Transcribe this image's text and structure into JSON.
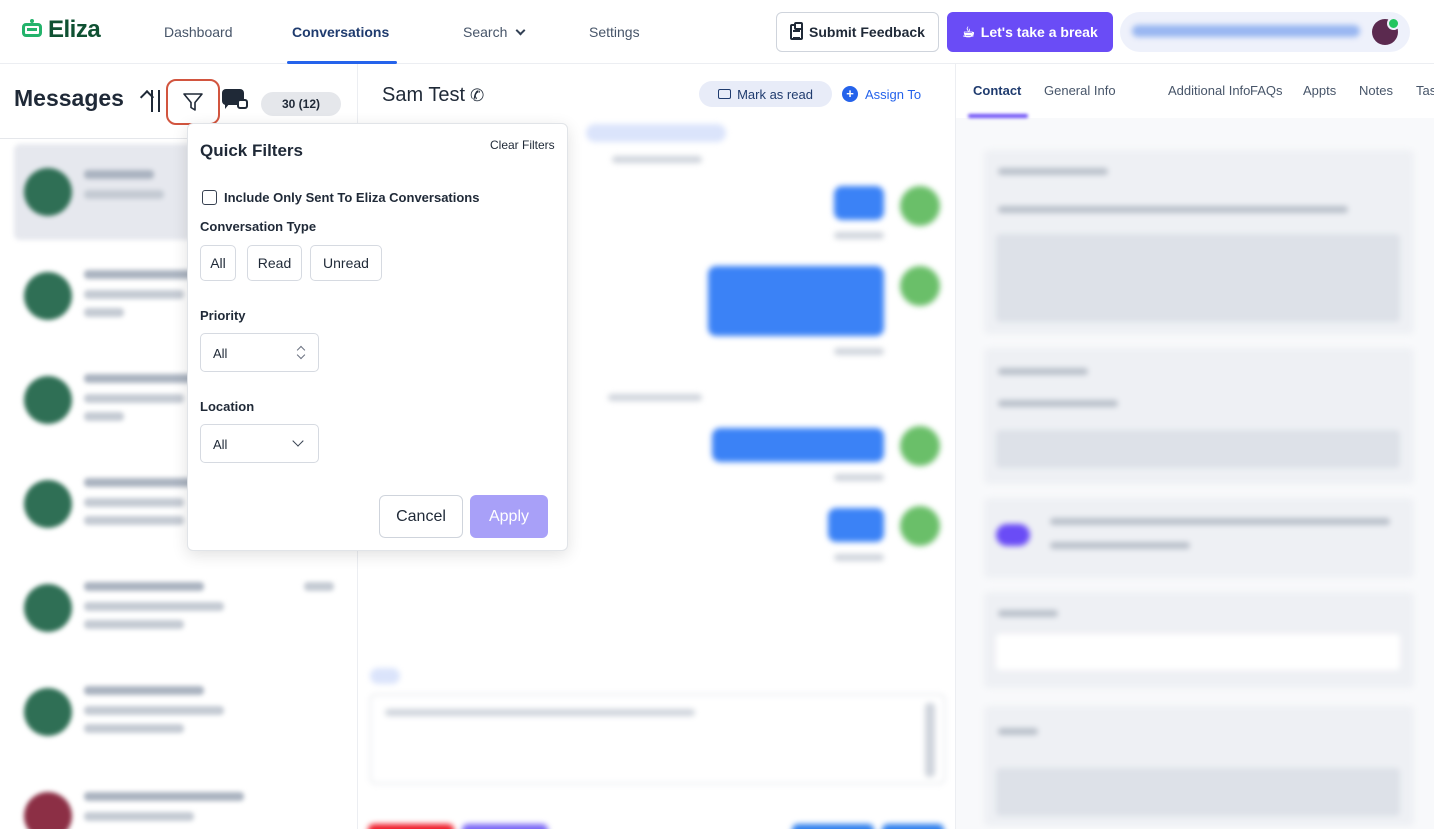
{
  "app": {
    "name": "Eliza"
  },
  "nav": {
    "links": [
      "Dashboard",
      "Conversations",
      "Search",
      "Settings"
    ],
    "active": "Conversations",
    "feedback_label": "Submit Feedback",
    "break_label": "Let's take a break"
  },
  "sidebar": {
    "title": "Messages",
    "count_badge": "30 (12)"
  },
  "chat": {
    "contact_name": "Sam Test",
    "mark_read_label": "Mark as read",
    "assign_label": "Assign To"
  },
  "right_panel": {
    "tabs": [
      "Contact",
      "General Info",
      "Additional Info",
      "FAQs",
      "Appts",
      "Notes",
      "Tas"
    ],
    "active_tab": "Contact"
  },
  "quick_filters": {
    "title": "Quick Filters",
    "clear_label": "Clear Filters",
    "checkbox_label": "Include Only Sent To Eliza Conversations",
    "checkbox_checked": false,
    "conversation_type_label": "Conversation Type",
    "conversation_types": [
      "All",
      "Read",
      "Unread"
    ],
    "priority_label": "Priority",
    "priority_value": "All",
    "location_label": "Location",
    "location_value": "All",
    "cancel_label": "Cancel",
    "apply_label": "Apply"
  },
  "colors": {
    "brand_green": "#23b36b",
    "accent_purple": "#6a4cf6",
    "link_blue": "#2563eb",
    "highlight_red": "#d2553f"
  }
}
